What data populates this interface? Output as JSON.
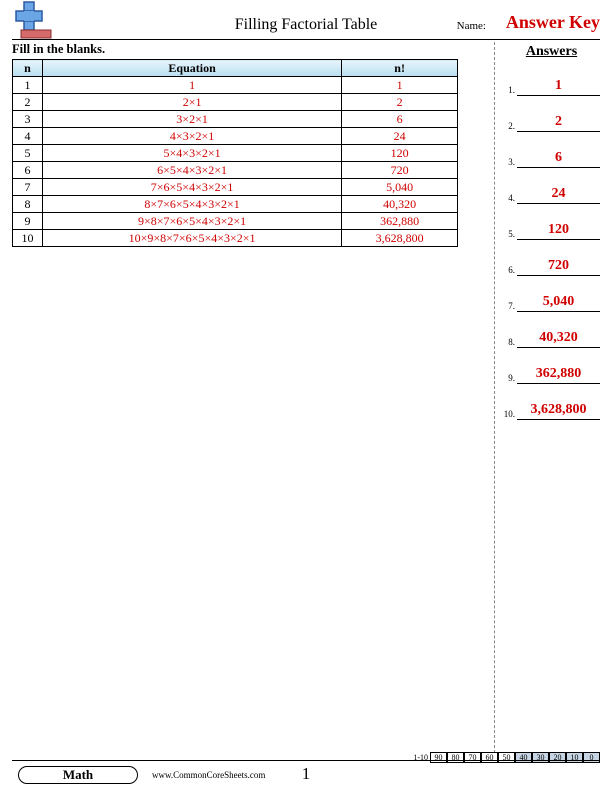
{
  "header": {
    "title": "Filling Factorial Table",
    "name_label": "Name:",
    "answer_key": "Answer Key"
  },
  "instructions": "Fill in the blanks.",
  "table": {
    "col_n": "n",
    "col_eq": "Equation",
    "col_nf": "n!",
    "rows": [
      {
        "n": "1",
        "eq": "1",
        "nf": "1"
      },
      {
        "n": "2",
        "eq": "2×1",
        "nf": "2"
      },
      {
        "n": "3",
        "eq": "3×2×1",
        "nf": "6"
      },
      {
        "n": "4",
        "eq": "4×3×2×1",
        "nf": "24"
      },
      {
        "n": "5",
        "eq": "5×4×3×2×1",
        "nf": "120"
      },
      {
        "n": "6",
        "eq": "6×5×4×3×2×1",
        "nf": "720"
      },
      {
        "n": "7",
        "eq": "7×6×5×4×3×2×1",
        "nf": "5,040"
      },
      {
        "n": "8",
        "eq": "8×7×6×5×4×3×2×1",
        "nf": "40,320"
      },
      {
        "n": "9",
        "eq": "9×8×7×6×5×4×3×2×1",
        "nf": "362,880"
      },
      {
        "n": "10",
        "eq": "10×9×8×7×6×5×4×3×2×1",
        "nf": "3,628,800"
      }
    ]
  },
  "answers": {
    "heading": "Answers",
    "items": [
      {
        "num": "1.",
        "val": "1"
      },
      {
        "num": "2.",
        "val": "2"
      },
      {
        "num": "3.",
        "val": "6"
      },
      {
        "num": "4.",
        "val": "24"
      },
      {
        "num": "5.",
        "val": "120"
      },
      {
        "num": "6.",
        "val": "720"
      },
      {
        "num": "7.",
        "val": "5,040"
      },
      {
        "num": "8.",
        "val": "40,320"
      },
      {
        "num": "9.",
        "val": "362,880"
      },
      {
        "num": "10.",
        "val": "3,628,800"
      }
    ]
  },
  "footer": {
    "subject": "Math",
    "url": "www.CommonCoreSheets.com",
    "page": "1",
    "score_label": "1-10",
    "scores": [
      "90",
      "80",
      "70",
      "60",
      "50",
      "40",
      "30",
      "20",
      "10",
      "0"
    ]
  }
}
